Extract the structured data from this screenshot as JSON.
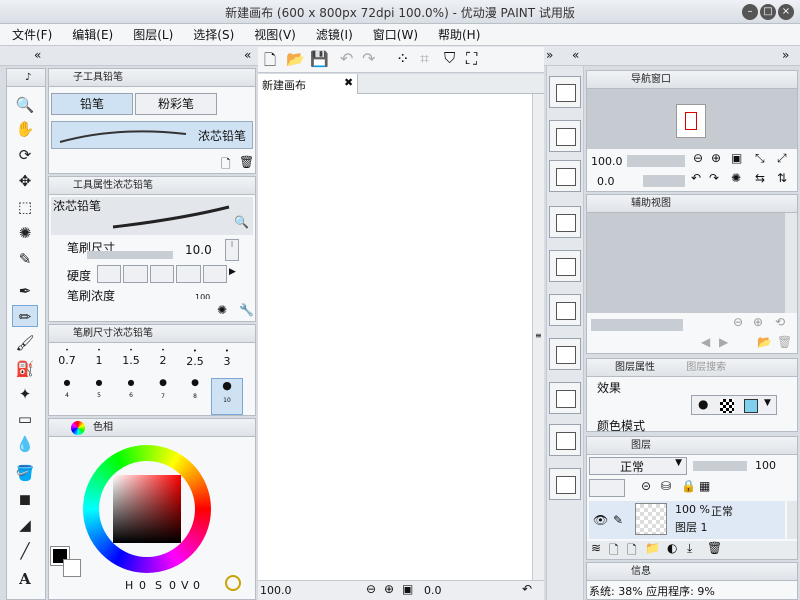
{
  "window": {
    "title": "新建画布 (600 x 800px 72dpi 100.0%)  - 优动漫 PAINT 试用版"
  },
  "menu": [
    "文件(F)",
    "编辑(E)",
    "图层(L)",
    "选择(S)",
    "视图(V)",
    "滤镜(I)",
    "窗口(W)",
    "帮助(H)"
  ],
  "subtool_panel": {
    "title": "子工具铅笔",
    "tabs": [
      "铅笔",
      "粉彩笔"
    ],
    "item": "浓芯铅笔"
  },
  "tool_property": {
    "title": "工具属性浓芯铅笔",
    "preset": "浓芯铅笔",
    "brush_size_label": "笔刷尺寸",
    "brush_size_value": "10.0",
    "hardness_label": "硬度",
    "density_label": "笔刷浓度",
    "density_value": "100"
  },
  "brush_size_panel": {
    "title": "笔刷尺寸浓芯铅笔",
    "row1": [
      "0.7",
      "1",
      "1.5",
      "2",
      "2.5",
      "3"
    ],
    "row2": [
      "4",
      "5",
      "6",
      "7",
      "8",
      "10"
    ]
  },
  "color_panel": {
    "tab": "色相",
    "h": "0",
    "s": "0",
    "v": "0"
  },
  "canvas": {
    "tab": "新建画布",
    "zoom": "100.0",
    "rotate": "0.0"
  },
  "navigator": {
    "title": "导航窗口",
    "zoom": "100.0",
    "rotate": "0.0"
  },
  "sub_view": {
    "title": "辅助视图"
  },
  "layer_property": {
    "tabs": [
      "图层属性",
      "图层搜索"
    ],
    "effect_label": "效果",
    "blend_label": "颜色模式"
  },
  "layer_panel": {
    "tab": "图层",
    "blend": "正常",
    "opacity": "100",
    "layer_percent": "100 %",
    "layer_mode": "正常",
    "layer_name": "图层 1"
  },
  "info": {
    "title": "信息",
    "text": "系统: 38% 应用程序: 9%"
  }
}
